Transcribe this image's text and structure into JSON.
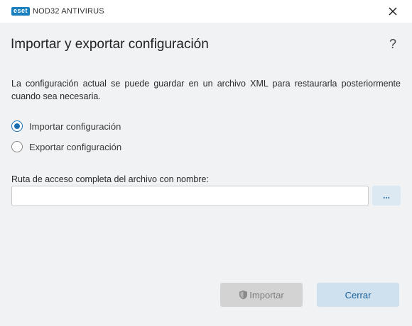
{
  "app": {
    "logo_badge": "eset",
    "logo_text": "NOD32 ANTIVIRUS",
    "brand_color": "#1a7fbf"
  },
  "header": {
    "title": "Importar y exportar configuración",
    "help_label": "?"
  },
  "description": "La configuración actual se puede guardar en un archivo XML para restaurarla posteriormente cuando sea necesaria.",
  "options": [
    {
      "label": "Importar configuración",
      "selected": true
    },
    {
      "label": "Exportar configuración",
      "selected": false
    }
  ],
  "path": {
    "label": "Ruta de acceso completa del archivo con nombre:",
    "value": "",
    "browse_label": "..."
  },
  "buttons": {
    "import_label": "Importar",
    "import_enabled": false,
    "close_label": "Cerrar"
  },
  "icons": {
    "close": "close-icon",
    "help": "help-icon",
    "shield": "shield-icon"
  }
}
